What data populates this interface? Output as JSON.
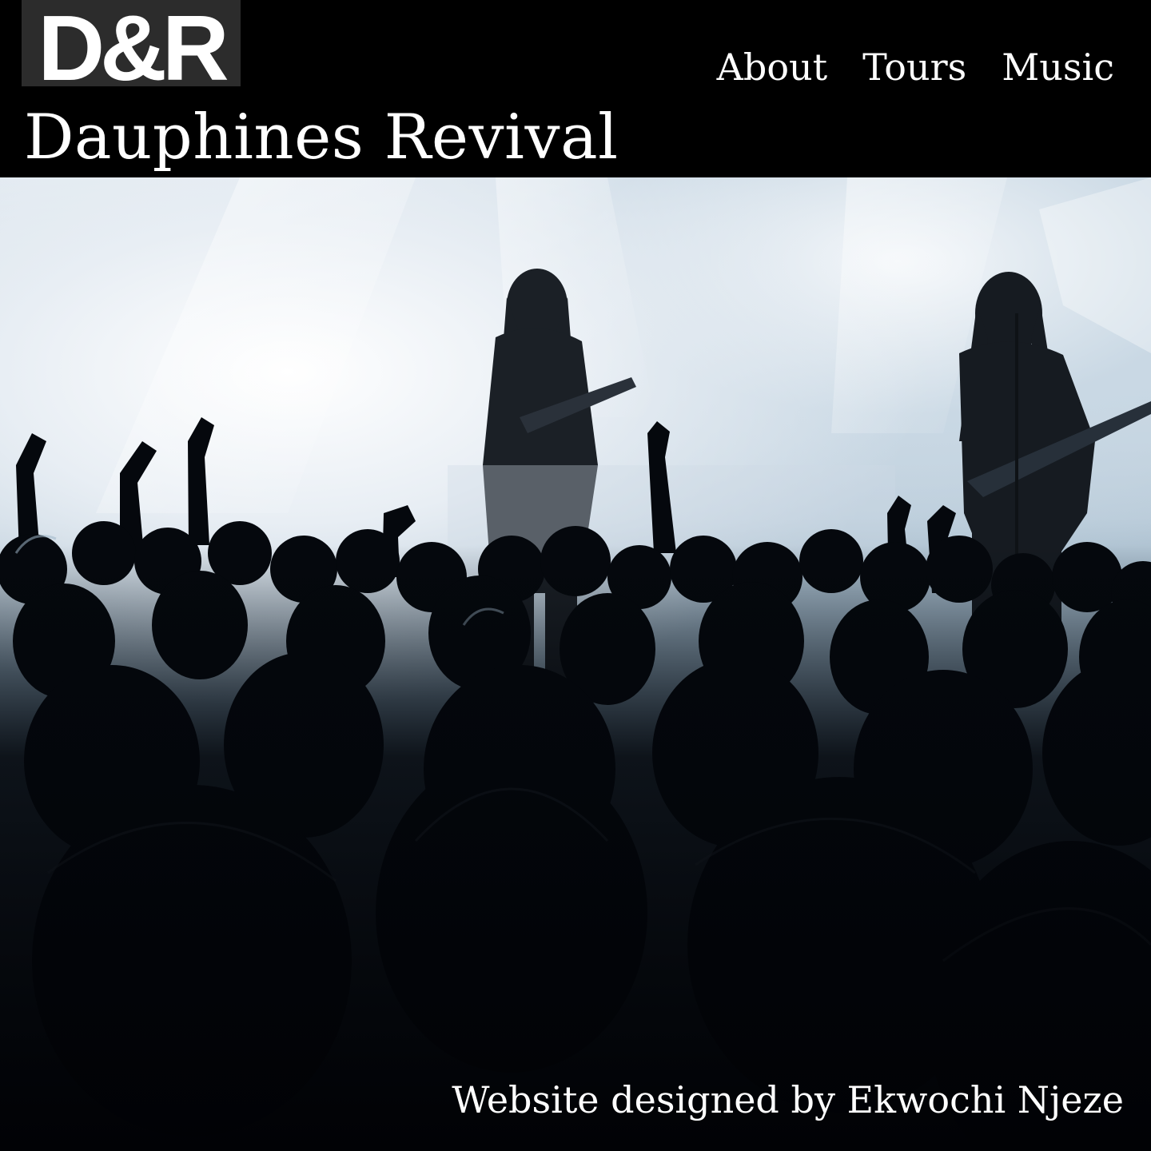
{
  "logo": {
    "text": "D&R",
    "icon": "band-logo"
  },
  "site_title": "Dauphines Revival",
  "nav": {
    "items": [
      {
        "label": "About"
      },
      {
        "label": "Tours"
      },
      {
        "label": "Music"
      }
    ]
  },
  "hero": {
    "image_description": "concert-crowd-photo",
    "colors": {
      "stage_light": "#eef3f8",
      "haze": "#9fb8cc",
      "crowd": "#02040a"
    }
  },
  "footer": {
    "credit": "Website designed by Ekwochi Njeze"
  }
}
